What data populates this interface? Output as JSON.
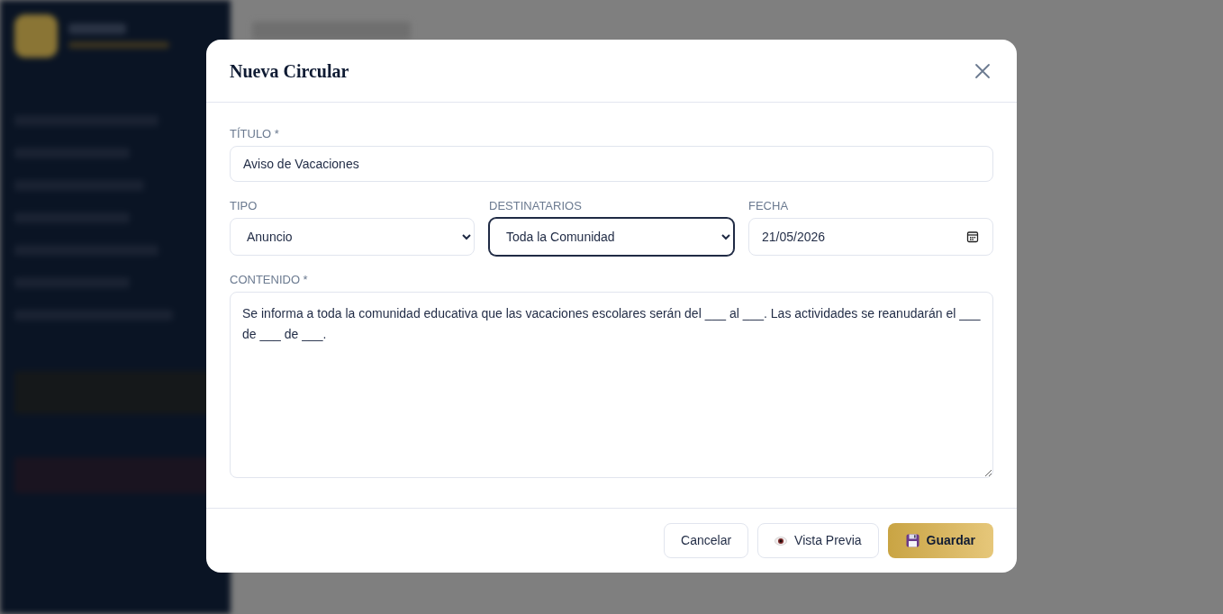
{
  "modal": {
    "title": "Nueva Circular",
    "fields": [
      {
        "kind": "text",
        "label": "TÍTULO *",
        "value": "Aviso de Vacaciones",
        "focused": false
      },
      {
        "kind": "select",
        "label": "TIPO",
        "value": "Anuncio",
        "focused": false
      },
      {
        "kind": "select",
        "label": "DESTINATARIOS",
        "value": "Toda la Comunidad",
        "focused": true
      },
      {
        "kind": "date",
        "label": "FECHA",
        "value": "21/05/2026",
        "focused": false
      },
      {
        "kind": "textarea",
        "label": "CONTENIDO *",
        "value": "Se informa a toda la comunidad educativa que las vacaciones escolares serán del ___ al ___. Las actividades se reanudarán el ___ de ___ de ___.",
        "focused": false
      }
    ],
    "buttons": [
      {
        "kind": "secondary",
        "label": "Cancelar"
      },
      {
        "kind": "preview",
        "label": "Vista Previa"
      },
      {
        "kind": "primary",
        "label": "Guardar"
      }
    ]
  }
}
